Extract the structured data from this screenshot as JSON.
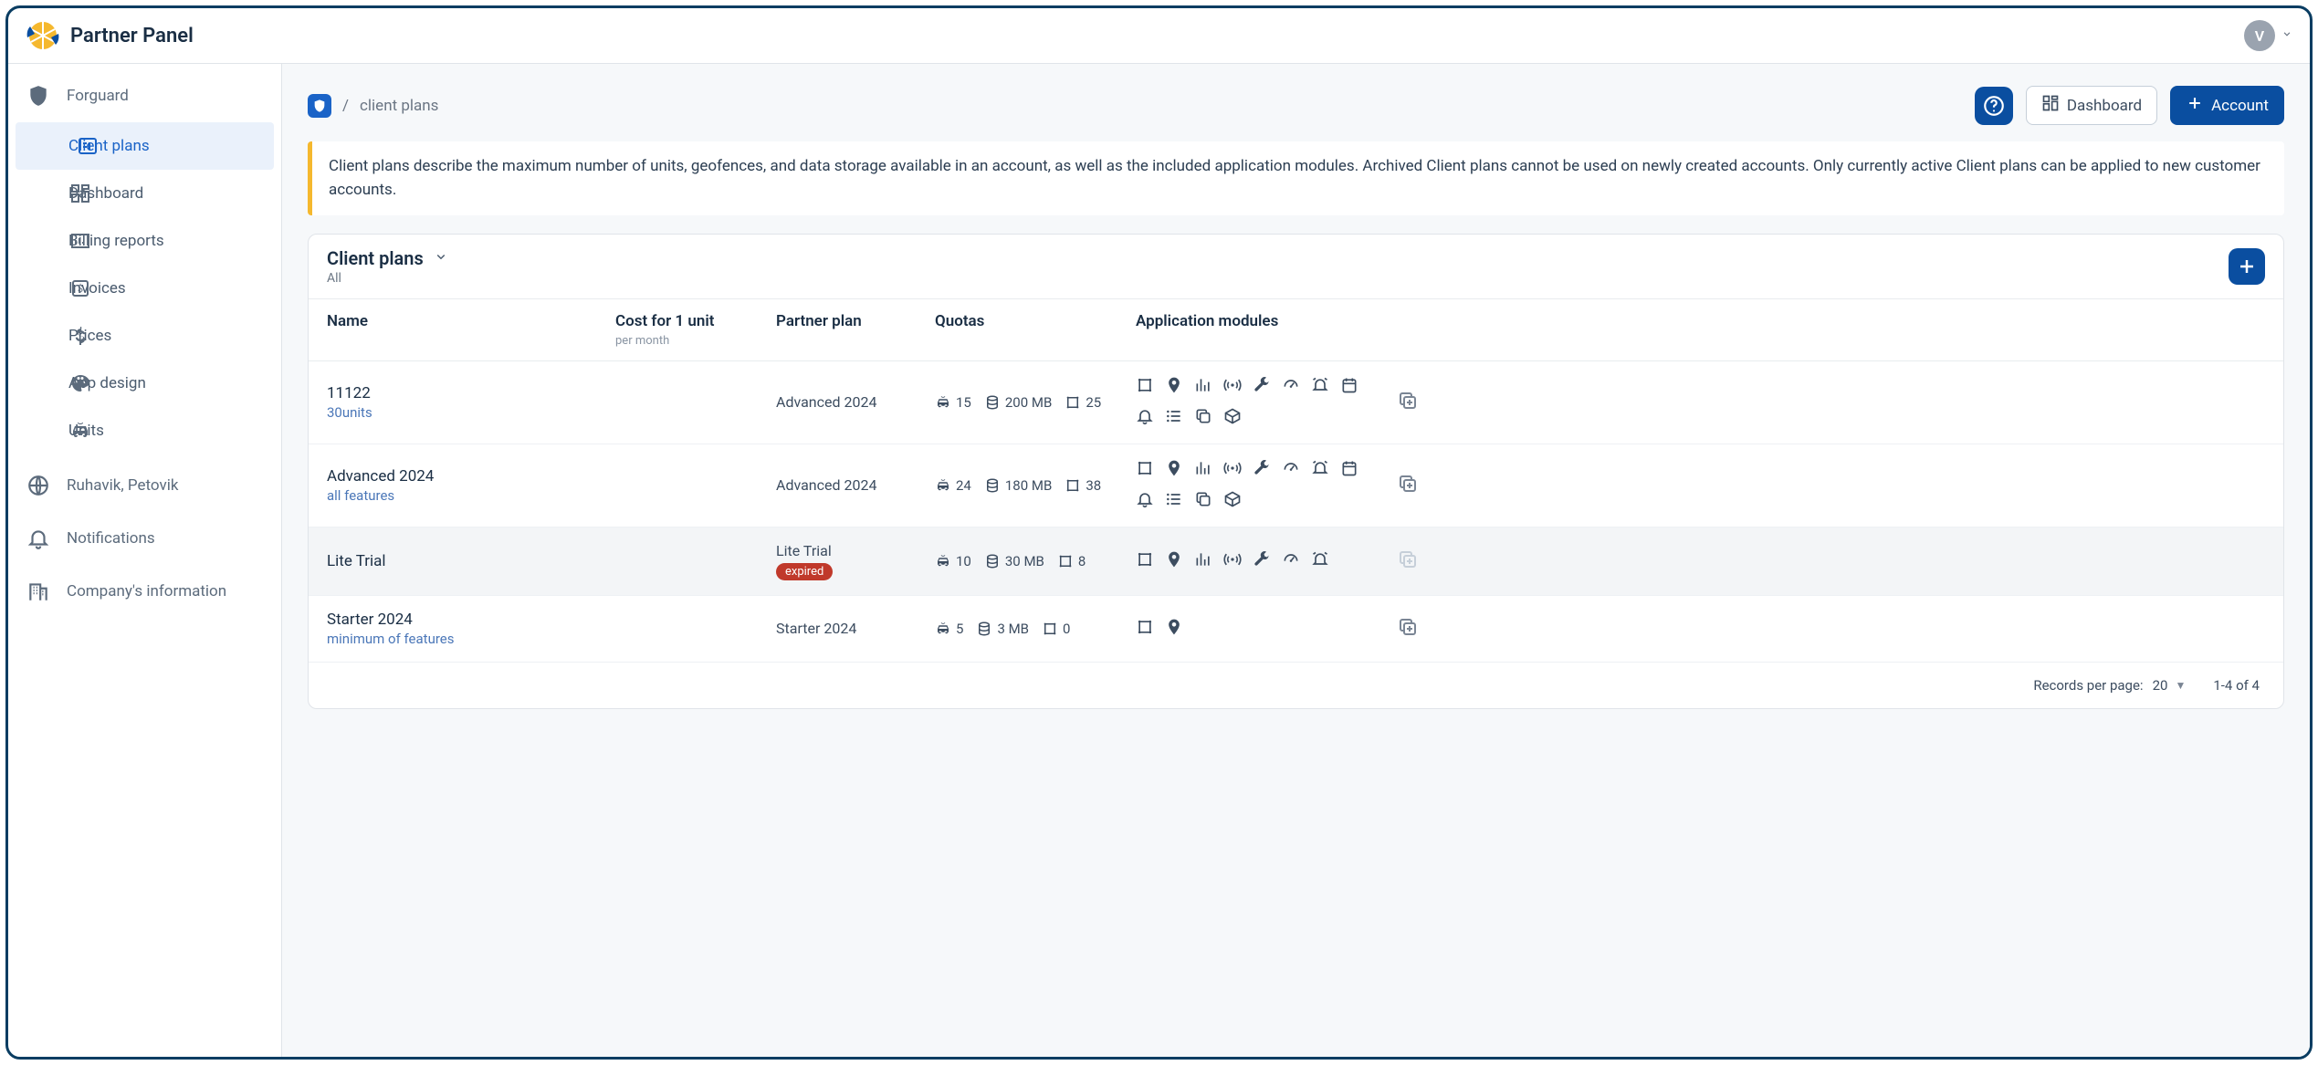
{
  "app": {
    "title": "Partner Panel",
    "avatar_initial": "V"
  },
  "sidebar": {
    "group1_title": "Forguard",
    "items": [
      {
        "label": "Client plans"
      },
      {
        "label": "Dashboard"
      },
      {
        "label": "Billing reports"
      },
      {
        "label": "Invoices"
      },
      {
        "label": "Prices"
      },
      {
        "label": "App design"
      },
      {
        "label": "Units"
      }
    ],
    "group2_title": "Ruhavik, Petovik",
    "group2_items": [
      {
        "label": "Notifications"
      },
      {
        "label": "Company's information"
      }
    ]
  },
  "breadcrumb": {
    "sep": "/",
    "current": "client plans"
  },
  "header_buttons": {
    "dashboard": "Dashboard",
    "account": "Account"
  },
  "banner": "Client plans describe the maximum number of units, geofences, and data storage available in an account, as well as the included application modules. Archived Client plans cannot be used on newly created accounts. Only currently active Client plans can be applied to new customer accounts.",
  "table": {
    "title": "Client plans",
    "filter": "All",
    "columns": {
      "name": "Name",
      "cost": "Cost for 1 unit",
      "cost_sub": "per month",
      "partner_plan": "Partner plan",
      "quotas": "Quotas",
      "modules": "Application modules"
    },
    "rows": [
      {
        "name": "11122",
        "sub": "30units",
        "partner_plan": "Advanced 2024",
        "expired": false,
        "quotas": {
          "units": "15",
          "storage": "200 MB",
          "geofences": "25"
        },
        "module_count": 12
      },
      {
        "name": "Advanced 2024",
        "sub": "all features",
        "partner_plan": "Advanced 2024",
        "expired": false,
        "quotas": {
          "units": "24",
          "storage": "180 MB",
          "geofences": "38"
        },
        "module_count": 12
      },
      {
        "name": "Lite Trial",
        "sub": "",
        "partner_plan": "Lite Trial",
        "expired": true,
        "expired_label": "expired",
        "quotas": {
          "units": "10",
          "storage": "30 MB",
          "geofences": "8"
        },
        "module_count": 7
      },
      {
        "name": "Starter 2024",
        "sub": "minimum of features",
        "partner_plan": "Starter 2024",
        "expired": false,
        "quotas": {
          "units": "5",
          "storage": "3 MB",
          "geofences": "0"
        },
        "module_count": 2
      }
    ],
    "footer": {
      "per_page_label": "Records per page:",
      "per_page_value": "20",
      "range": "1-4 of 4"
    }
  }
}
